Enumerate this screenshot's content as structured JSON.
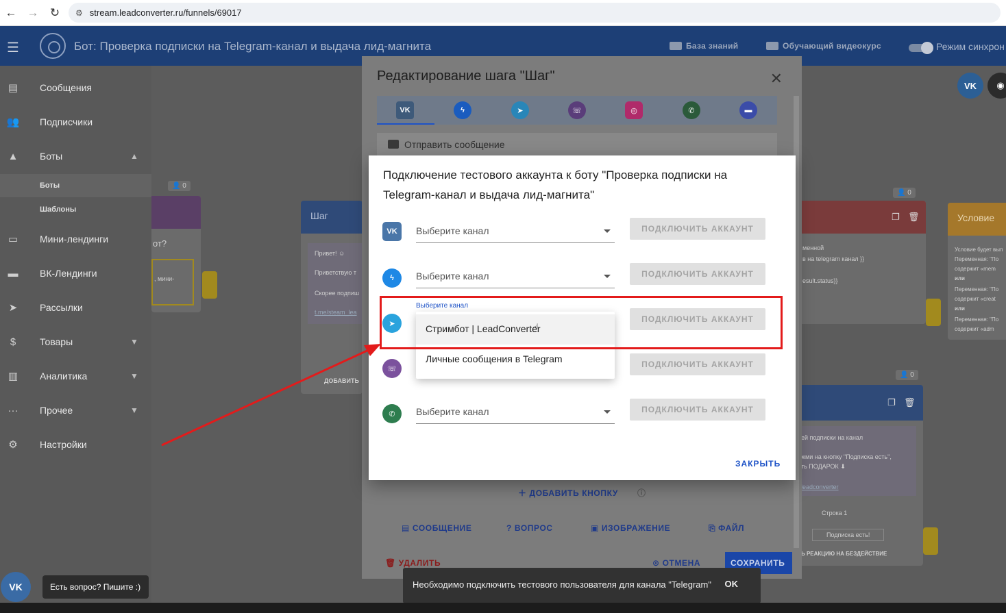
{
  "browser": {
    "url": "stream.leadconverter.ru/funnels/69017"
  },
  "header": {
    "title": "Бот: Проверка подписки на Telegram-канал и выдача лид-магнита",
    "knowledge_base": "База знаний",
    "video_course": "Обучающий видеокурс",
    "sync_mode": "Режим синхрон"
  },
  "sidebar": {
    "items": [
      {
        "label": "Сообщения",
        "icon": "chat-icon"
      },
      {
        "label": "Подписчики",
        "icon": "people-icon"
      },
      {
        "label": "Боты",
        "icon": "android-icon"
      },
      {
        "label": "Боты",
        "icon": ""
      },
      {
        "label": "Шаблоны",
        "icon": ""
      },
      {
        "label": "Мини-лендинги",
        "icon": "window-icon"
      },
      {
        "label": "ВК-Лендинги",
        "icon": "card-icon"
      },
      {
        "label": "Рассылки",
        "icon": "send-icon"
      },
      {
        "label": "Товары",
        "icon": "dollar-icon"
      },
      {
        "label": "Аналитика",
        "icon": "chart-icon"
      },
      {
        "label": "Прочее",
        "icon": "more-icon"
      },
      {
        "label": "Настройки",
        "icon": "gear-icon"
      }
    ]
  },
  "canvas": {
    "counter": "0",
    "node_left_question": "от?",
    "node_left_mini": ", мини-",
    "node_step_title": "Шаг",
    "node_step_lines": [
      "Привет! ☺",
      "Приветствую т",
      "Скорее подпиш",
      "t.me/steam_lea"
    ],
    "node_step_add": "ДОБАВИТЬ",
    "node_right_lines": [
      "менной",
      "в на telegram канал }}",
      "esult.status}}"
    ],
    "condition_title": "Условие",
    "condition_lines": [
      "Условие будет вып",
      "Переменная: \"По",
      "содержит «mem",
      "или",
      "Переменная: \"По",
      "содержит «creat",
      "или",
      "Переменная: \"По",
      "содержит «adm"
    ],
    "node_bottom_lines": [
      "ей подписки на канал",
      "жми на кнопку \"Подписка есть\",",
      "ть ПОДАРОК ⬇",
      "leadconverter",
      "Строка 1",
      "Подписка есть!",
      "Ь РЕАКЦИЮ НА БЕЗДЕЙСТВИЕ"
    ]
  },
  "step_dialog": {
    "title": "Редактирование шага \"Шаг\"",
    "send_message": "Отправить сообщение",
    "add_button": "ДОБАВИТЬ КНОПКУ",
    "footer": {
      "message": "СООБЩЕНИЕ",
      "question": "ВОПРОС",
      "image": "ИЗОБРАЖЕНИЕ",
      "file": "ФАЙЛ",
      "delete": "УДАЛИТЬ",
      "cancel": "ОТМЕНА",
      "save": "СОХРАНИТЬ"
    }
  },
  "modal": {
    "title": "Подключение тестового аккаунта к боту \"Проверка подписки на Telegram-канал и выдача лид-магнита\"",
    "select_placeholder": "Выберите канал",
    "connect_label": "ПОДКЛЮЧИТЬ АККАУНТ",
    "float_label": "Выберите канал",
    "dropdown_options": [
      "Стримбот | LeadConverter",
      "Личные сообщения в Telegram"
    ],
    "close": "ЗАКРЫТЬ"
  },
  "snackbar": {
    "text": "Необходимо подключить тестового пользователя для канала \"Telegram\"",
    "ok": "OK"
  },
  "chat_widget": {
    "tip": "Есть вопрос? Пишите :)"
  },
  "colors": {
    "vk": "#4a76a8",
    "messenger": "#1e88e5",
    "telegram": "#2aa3dd",
    "viber": "#7b519d",
    "whatsapp": "#2e7d4f",
    "instagram": "#d62976",
    "primary_blue": "#1e53c7",
    "annotation_red": "#e31b1b"
  }
}
